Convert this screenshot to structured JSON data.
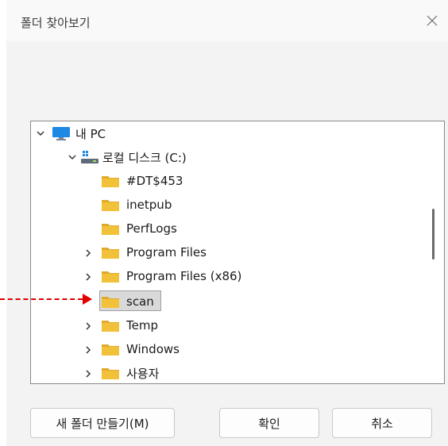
{
  "dialog": {
    "title": "폴더 찾아보기",
    "close_icon": "close-icon"
  },
  "tree": {
    "root": {
      "label": "내 PC",
      "icon": "monitor-icon"
    },
    "drive": {
      "label": "로컬 디스크 (C:)",
      "icon": "drive-icon"
    },
    "folders": [
      {
        "label": "#DT$453",
        "has_children": false,
        "selected": false
      },
      {
        "label": "inetpub",
        "has_children": false,
        "selected": false
      },
      {
        "label": "PerfLogs",
        "has_children": false,
        "selected": false
      },
      {
        "label": "Program Files",
        "has_children": true,
        "selected": false
      },
      {
        "label": "Program Files (x86)",
        "has_children": true,
        "selected": false
      },
      {
        "label": "scan",
        "has_children": false,
        "selected": true
      },
      {
        "label": "Temp",
        "has_children": true,
        "selected": false
      },
      {
        "label": "Windows",
        "has_children": true,
        "selected": false
      },
      {
        "label": "사용자",
        "has_children": true,
        "selected": false
      }
    ]
  },
  "buttons": {
    "new_folder": "새 폴더 만들기(M)",
    "ok": "확인",
    "cancel": "취소"
  },
  "colors": {
    "folder": "#f2c13a",
    "folder_dark": "#e0a92a",
    "monitor": "#1e88e5",
    "annotation_arrow": "#e00000"
  }
}
